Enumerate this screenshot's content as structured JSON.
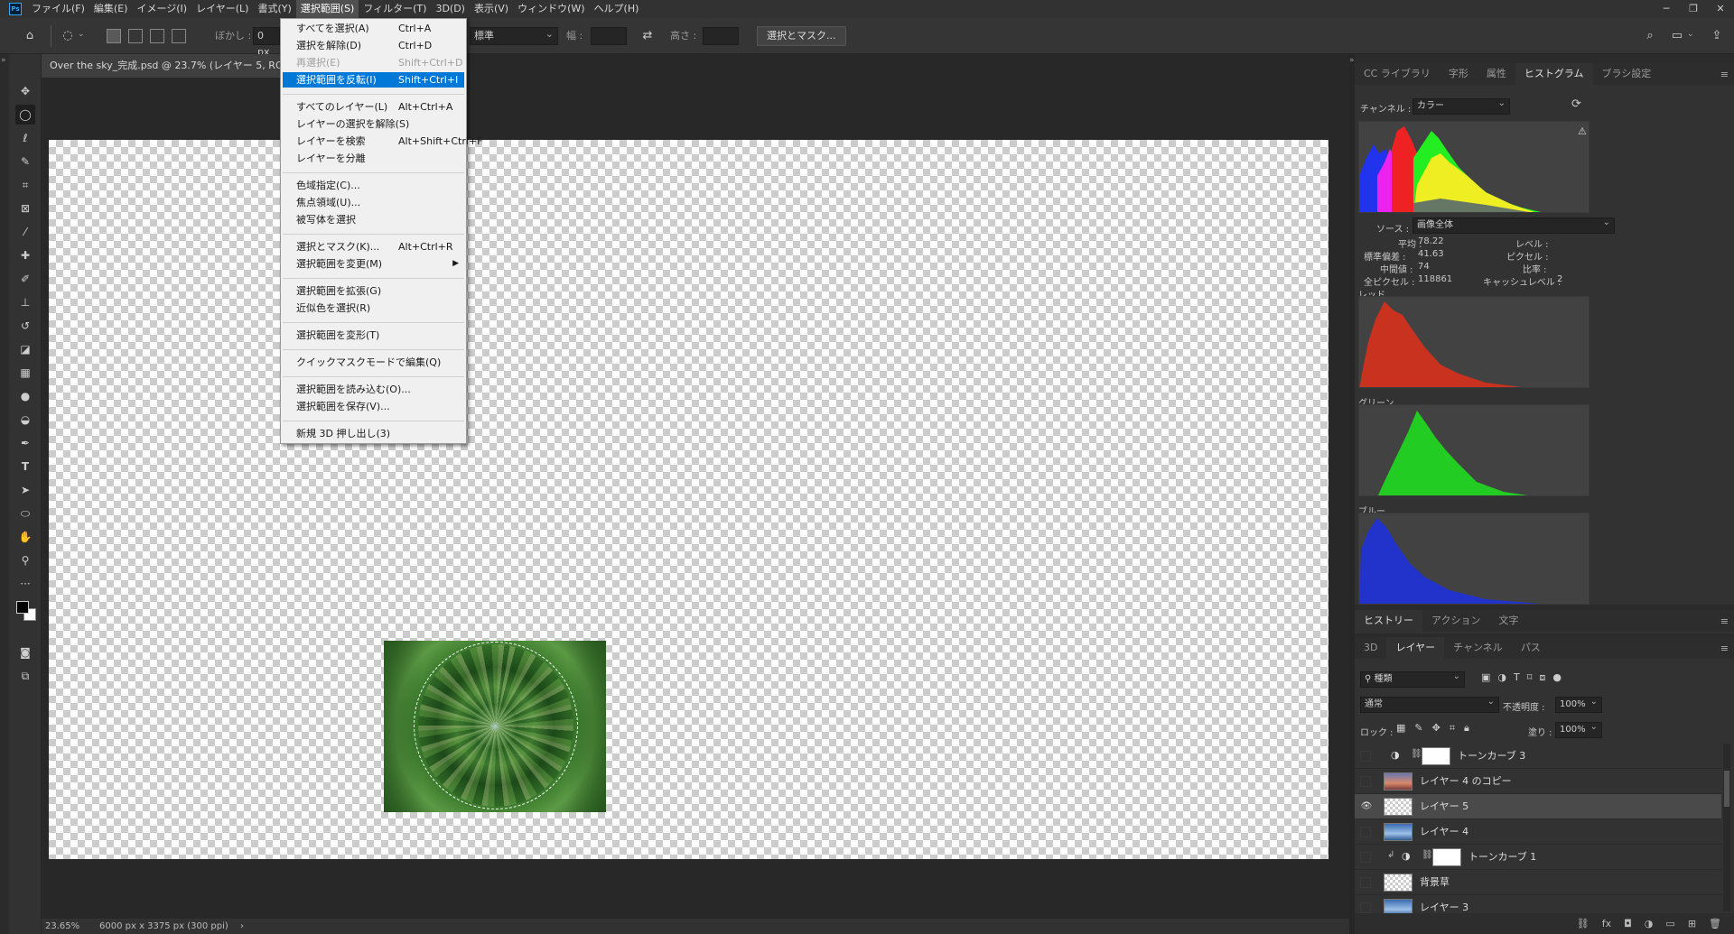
{
  "menubar": {
    "items": [
      "ファイル(F)",
      "編集(E)",
      "イメージ(I)",
      "レイヤー(L)",
      "書式(Y)",
      "選択範囲(S)",
      "フィルター(T)",
      "3D(D)",
      "表示(V)",
      "ウィンドウ(W)",
      "ヘルプ(H)"
    ],
    "active_index": 5
  },
  "options": {
    "feather_label": "ぼかし :",
    "feather_value": "0 px",
    "style_value": "標準",
    "width_label": "幅 :",
    "height_label": "高さ :",
    "select_mask_button": "選択とマスク..."
  },
  "document": {
    "tab_title": "Over the sky_完成.psd @ 23.7% (レイヤー 5, RGB/8)",
    "zoom": "23.65%",
    "dimensions": "6000 px x 3375 px (300 ppi)"
  },
  "select_menu": {
    "items": [
      {
        "label": "すべてを選択(A)",
        "shortcut": "Ctrl+A",
        "state": "normal"
      },
      {
        "label": "選択を解除(D)",
        "shortcut": "Ctrl+D",
        "state": "normal"
      },
      {
        "label": "再選択(E)",
        "shortcut": "Shift+Ctrl+D",
        "state": "disabled"
      },
      {
        "label": "選択範囲を反転(I)",
        "shortcut": "Shift+Ctrl+I",
        "state": "highlighted"
      },
      {
        "label": "すべてのレイヤー(L)",
        "shortcut": "Alt+Ctrl+A",
        "state": "normal"
      },
      {
        "label": "レイヤーの選択を解除(S)",
        "shortcut": "",
        "state": "normal"
      },
      {
        "label": "レイヤーを検索",
        "shortcut": "Alt+Shift+Ctrl+F",
        "state": "normal"
      },
      {
        "label": "レイヤーを分離",
        "shortcut": "",
        "state": "normal"
      },
      {
        "label": "色域指定(C)...",
        "shortcut": "",
        "state": "normal"
      },
      {
        "label": "焦点領域(U)...",
        "shortcut": "",
        "state": "normal"
      },
      {
        "label": "被写体を選択",
        "shortcut": "",
        "state": "normal"
      },
      {
        "label": "選択とマスク(K)...",
        "shortcut": "Alt+Ctrl+R",
        "state": "normal"
      },
      {
        "label": "選択範囲を変更(M)",
        "shortcut": "",
        "state": "submenu"
      },
      {
        "label": "選択範囲を拡張(G)",
        "shortcut": "",
        "state": "normal"
      },
      {
        "label": "近似色を選択(R)",
        "shortcut": "",
        "state": "normal"
      },
      {
        "label": "選択範囲を変形(T)",
        "shortcut": "",
        "state": "normal"
      },
      {
        "label": "クイックマスクモードで編集(Q)",
        "shortcut": "",
        "state": "normal"
      },
      {
        "label": "選択範囲を読み込む(O)...",
        "shortcut": "",
        "state": "normal"
      },
      {
        "label": "選択範囲を保存(V)...",
        "shortcut": "",
        "state": "normal"
      },
      {
        "label": "新規 3D 押し出し(3)",
        "shortcut": "",
        "state": "normal"
      }
    ]
  },
  "top_panel": {
    "tabs": [
      "CC ライブラリ",
      "字形",
      "属性",
      "ヒストグラム",
      "ブラシ設定"
    ],
    "active_tab": 3,
    "channel_label": "チャンネル :",
    "channel_value": "カラー",
    "source_label": "ソース :",
    "source_value": "画像全体",
    "stats": {
      "mean_label": "平均 :",
      "mean": "78.22",
      "stddev_label": "標準偏差 :",
      "stddev": "41.63",
      "median_label": "中間値 :",
      "median": "74",
      "pixels_label": "全ピクセル :",
      "pixels": "118861",
      "level_label": "レベル :",
      "count_label": "ピクセル :",
      "percentile_label": "比率 :",
      "cache_label": "キャッシュレベル :",
      "cache": "2"
    },
    "red_label": "レッド",
    "green_label": "グリーン",
    "blue_label": "ブルー"
  },
  "history_tabs": {
    "tabs": [
      "ヒストリー",
      "アクション",
      "文字"
    ],
    "active_tab": 0
  },
  "layers_panel": {
    "tabs": [
      "3D",
      "レイヤー",
      "チャンネル",
      "パス"
    ],
    "active_tab": 1,
    "filter_value": "種類",
    "blend_mode": "通常",
    "opacity_label": "不透明度 :",
    "opacity_value": "100%",
    "lock_label": "ロック :",
    "fill_label": "塗り :",
    "fill_value": "100%",
    "layers": [
      {
        "name": "トーンカーブ 3",
        "kind": "adjustment",
        "visible": false,
        "selected": false
      },
      {
        "name": "レイヤー 4 のコピー",
        "kind": "sunset",
        "visible": false,
        "selected": false
      },
      {
        "name": "レイヤー 5",
        "kind": "checker",
        "visible": true,
        "selected": true
      },
      {
        "name": "レイヤー 4",
        "kind": "sky",
        "visible": false,
        "selected": false
      },
      {
        "name": "トーンカーブ 1",
        "kind": "adjustment-clipped",
        "visible": false,
        "selected": false
      },
      {
        "name": "背景草",
        "kind": "checker",
        "visible": false,
        "selected": false
      },
      {
        "name": "レイヤー 3",
        "kind": "sky",
        "visible": false,
        "selected": false
      }
    ]
  },
  "colors": {
    "accent": "#0078d7",
    "red_hist": "#c8321e",
    "green_hist": "#22cc22",
    "blue_hist": "#2233cc"
  }
}
